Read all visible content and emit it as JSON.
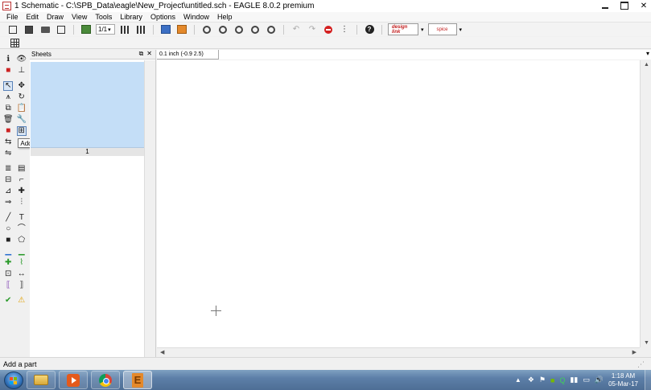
{
  "window": {
    "title": "1 Schematic - C:\\SPB_Data\\eagle\\New_Project\\untitled.sch - EAGLE 8.0.2 premium"
  },
  "menu": [
    "File",
    "Edit",
    "Draw",
    "View",
    "Tools",
    "Library",
    "Options",
    "Window",
    "Help"
  ],
  "toolbar": {
    "sheet_select": "1/1",
    "design_link_label": "design link",
    "spice_label": "spice"
  },
  "sheets_panel": {
    "title": "Sheets",
    "sheet_number": "1"
  },
  "coordinate_display": "0.1 inch (-0.9 2.5)",
  "command_line": {
    "value": ""
  },
  "tooltip": "Add",
  "status_bar": "Add a part",
  "taskbar": {
    "time": "1:18 AM",
    "date": "05-Mar-17"
  },
  "colors": {
    "sheet_area": "#c4def7",
    "taskbar": "#5d7fa8",
    "stop": "#d42020"
  }
}
